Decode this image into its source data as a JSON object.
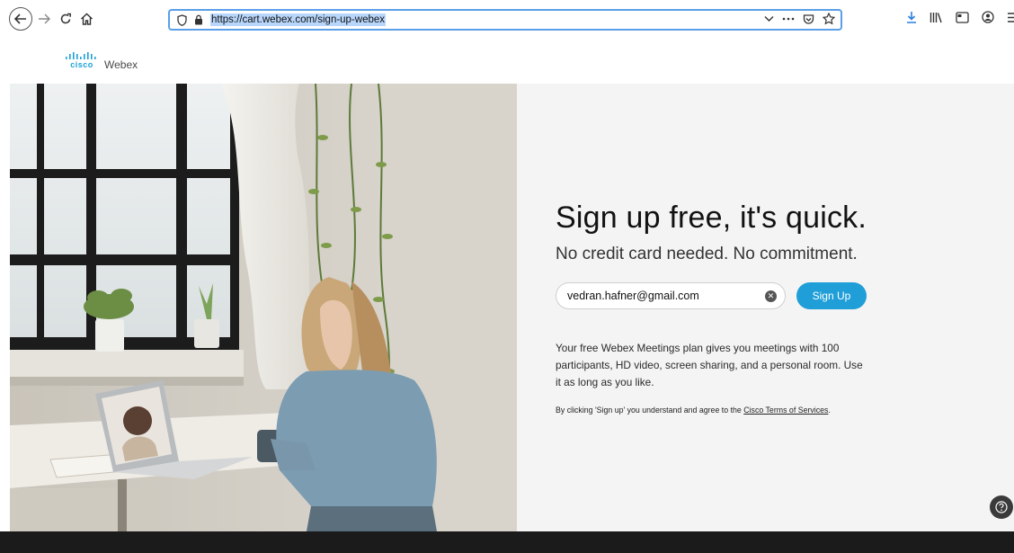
{
  "browser": {
    "url": "https://cart.webex.com/sign-up-webex"
  },
  "brand": {
    "cisco": "cisco",
    "product": "Webex"
  },
  "signup": {
    "headline": "Sign up free, it's quick.",
    "subheadline": "No credit card needed. No commitment.",
    "email_value": "vedran.hafner@gmail.com",
    "button_label": "Sign Up",
    "description": "Your free Webex Meetings plan gives you meetings with 100 participants, HD video, screen sharing, and a personal room. Use it as long as you like.",
    "terms_prefix": "By clicking 'Sign up' you understand and agree to the ",
    "terms_link": "Cisco Terms of Services",
    "terms_suffix": "."
  },
  "colors": {
    "accent": "#1f9ed8",
    "cisco_blue": "#1ba0d7",
    "footer": "#1b1b1b"
  }
}
